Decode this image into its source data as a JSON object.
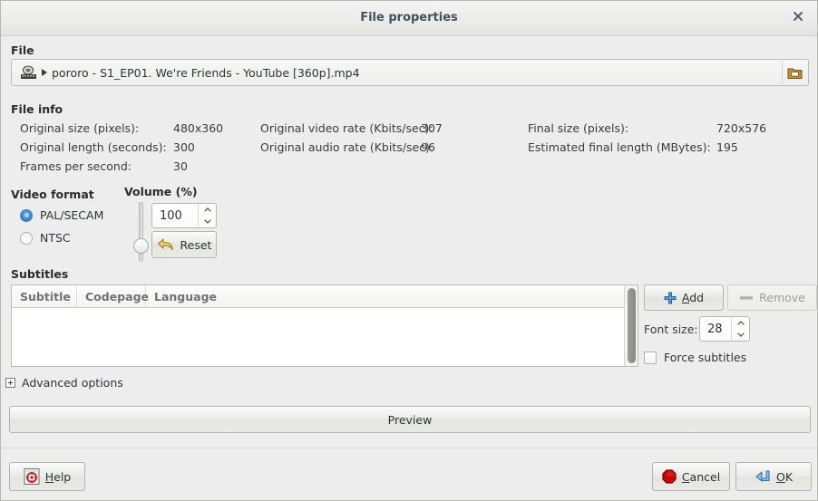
{
  "window": {
    "title": "File properties",
    "close_icon": "close-icon"
  },
  "file_section": {
    "label": "File",
    "media_icon": "film-reel-icon",
    "filename": "pororo - S1_EP01. We're Friends - YouTube [360p].mp4",
    "browse_icon": "folder-icon"
  },
  "file_info": {
    "label": "File info",
    "rows": [
      {
        "label": "Original size (pixels):",
        "value": "480x360"
      },
      {
        "label": "Original length (seconds):",
        "value": "300"
      },
      {
        "label": "Frames per second:",
        "value": "30"
      }
    ],
    "rates": [
      {
        "label": "Original video rate (Kbits/sec):",
        "value": "307"
      },
      {
        "label": "Original audio rate (Kbits/sec):",
        "value": "96"
      }
    ],
    "final": [
      {
        "label": "Final size (pixels):",
        "value": "720x576"
      },
      {
        "label": "Estimated final length (MBytes):",
        "value": "195"
      }
    ]
  },
  "video_format": {
    "label": "Video format",
    "options": [
      {
        "label": "PAL/SECAM",
        "selected": true
      },
      {
        "label": "NTSC",
        "selected": false
      }
    ]
  },
  "volume": {
    "label": "Volume (%)",
    "value": "100",
    "slider_percent": 18,
    "reset_label": "Reset",
    "reset_icon": "undo-arrow-icon",
    "up_icon": "chevron-up-icon",
    "down_icon": "chevron-down-icon"
  },
  "subtitles": {
    "label": "Subtitles",
    "columns": [
      "Subtitle",
      "Codepage",
      "Language"
    ],
    "rows": [],
    "add_label": "Add",
    "add_accel": "A",
    "add_icon": "plus-icon",
    "remove_label": "Remove",
    "remove_icon": "remove-icon",
    "remove_disabled": true,
    "font_size_label": "Font size:",
    "font_size_value": "28",
    "force_label": "Force subtitles",
    "force_checked": false
  },
  "advanced": {
    "label": "Advanced options",
    "expanded": false,
    "expander_icon": "plus-box-icon"
  },
  "preview": {
    "label": "Preview"
  },
  "footer": {
    "help_label": "Help",
    "help_accel": "H",
    "help_icon": "lifebuoy-icon",
    "cancel_label": "Cancel",
    "cancel_accel": "C",
    "cancel_icon": "stop-icon",
    "ok_label": "OK",
    "ok_accel": "O",
    "ok_icon": "enter-arrow-icon"
  },
  "colors": {
    "window_bg": "#ededed",
    "accent_blue": "#3b84d0",
    "cancel_red": "#cc0000",
    "reset_yellow": "#e8c33a",
    "title_text": "#41525c"
  }
}
